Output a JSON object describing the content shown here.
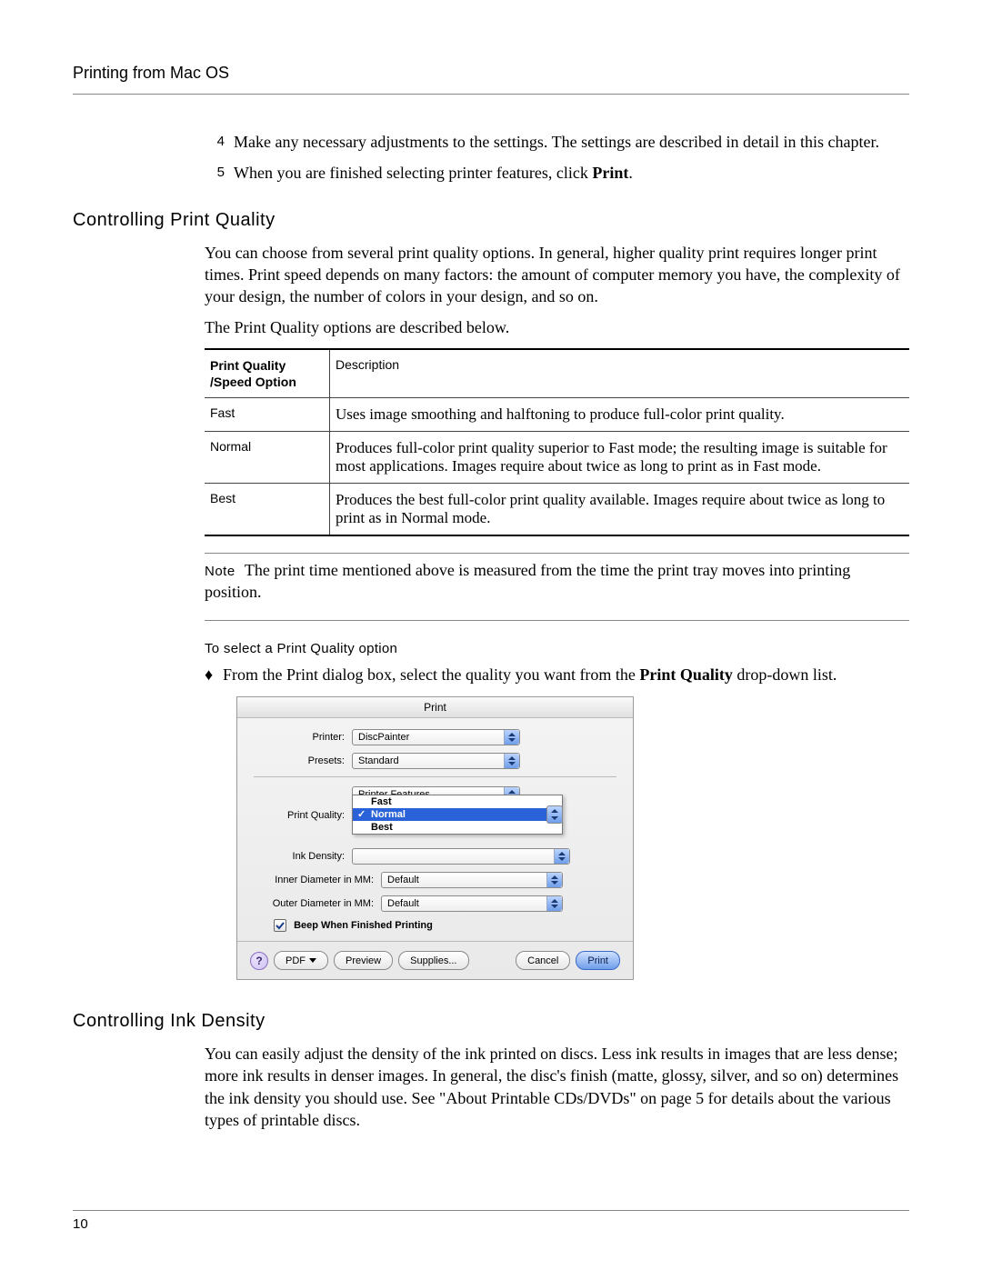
{
  "header": {
    "title": "Printing from Mac OS"
  },
  "steps": [
    {
      "n": "4",
      "t_a": "Make any necessary adjustments to the settings. The settings are described in detail in this chapter."
    },
    {
      "n": "5",
      "t_a": "When you are finished selecting printer features, click ",
      "t_b_bold": "Print",
      "t_c": "."
    }
  ],
  "s1": {
    "heading": "Controlling Print Quality",
    "p1": "You can choose from several print quality options. In general, higher quality print requires longer print times. Print speed depends on many factors: the amount of computer memory you have, the complexity of your design, the number of colors in your design, and so on.",
    "p2": "The Print Quality options are described below.",
    "th1a": "Print Quality",
    "th1b": "/Speed Option",
    "th2": "Description",
    "rows": [
      {
        "name": "Fast",
        "desc": "Uses image smoothing and halftoning to produce full-color print quality."
      },
      {
        "name": "Normal",
        "desc": "Produces full-color print quality superior to Fast mode; the resulting image is suitable for most applications. Images require about twice as long to print as in Fast mode."
      },
      {
        "name": "Best",
        "desc": "Produces the best full-color print quality available. Images require about twice as long to print as in Normal mode."
      }
    ],
    "note_word": "Note",
    "note": "The print time mentioned above is measured from the time the print tray moves into printing position.",
    "h3": "To select a Print Quality option",
    "bullet_a": "From the Print dialog box, select the quality you want from the ",
    "bullet_bold": "Print Quality",
    "bullet_b": " drop-down list."
  },
  "dlg": {
    "title": "Print",
    "printer_lbl": "Printer:",
    "printer_val": "DiscPainter",
    "presets_lbl": "Presets:",
    "presets_val": "Standard",
    "pane_val": "Printer Features",
    "pq_lbl": "Print Quality:",
    "pq_options": [
      "Fast",
      "Normal",
      "Best"
    ],
    "pq_selected": "Normal",
    "ink_lbl": "Ink Density:",
    "inner_lbl": "Inner Diameter in MM:",
    "inner_val": "Default",
    "outer_lbl": "Outer Diameter in MM:",
    "outer_val": "Default",
    "beep": "Beep When Finished Printing",
    "help": "?",
    "pdf": "PDF",
    "preview": "Preview",
    "supplies": "Supplies...",
    "cancel": "Cancel",
    "print": "Print"
  },
  "s2": {
    "heading": "Controlling Ink Density",
    "p1": "You can easily adjust the density of the ink printed on discs. Less ink results in images that are less dense; more ink results in denser images. In general, the disc's finish (matte, glossy, silver, and so on) determines the ink density you should use. See \"About Printable CDs/DVDs\" on page 5 for details about the various types of printable discs."
  },
  "footer": {
    "page": "10"
  }
}
